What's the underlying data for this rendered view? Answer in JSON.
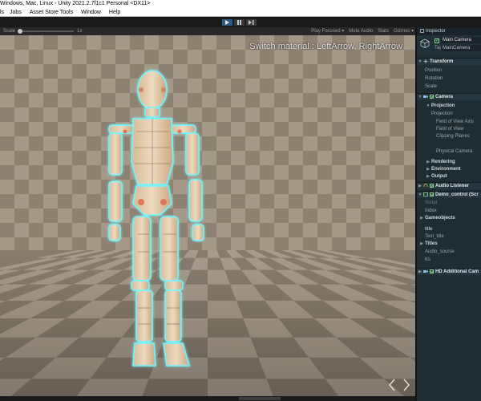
{
  "window": {
    "title": "Windows, Mac, Linux - Unity 2021.2.7f1c1 Personal <DX11>"
  },
  "menu": [
    "ls",
    "Jobs",
    "Asset Store Tools",
    "Window",
    "Help"
  ],
  "game_toolbar": {
    "scale_label": "Scale",
    "scale_value": "1x",
    "play_focused": "Play Focused",
    "mute_audio": "Mute Audio",
    "stats": "Stats",
    "gizmos": "Gizmos"
  },
  "viewport": {
    "switch_text": "Switch material : LeftArrow, RightArrow"
  },
  "inspector": {
    "tab_label": "Inspector",
    "object_name": "Main Camera",
    "tag_label": "Tag",
    "tag_value": "MainCamera",
    "rows": {
      "transform": "Transform",
      "position": "Position",
      "rotation": "Rotation",
      "scale": "Scale",
      "camera": "Camera",
      "projection_group": "Projection",
      "projection": "Projection",
      "fov_axis": "Field of View Axis",
      "fov": "Field of View",
      "clipping": "Clipping Planes",
      "physical_camera": "Physical Camera",
      "rendering": "Rendering",
      "environment": "Environment",
      "output": "Output",
      "audio_listener": "Audio Listener",
      "demo_control": "Demo_control (Scr",
      "script": "Script",
      "index": "Index",
      "gameobjects": "Gameobjects",
      "title": "title",
      "text_title": "Text_title",
      "titles": "Titles",
      "audio_source": "Audio_source",
      "ks": "Ks",
      "hd_camera": "HD Additional Cam"
    }
  },
  "colors": {
    "accent_play": "#2c5d87",
    "inspector_bg": "#1f2d33",
    "hologram_edge": "#6ef5ff",
    "body_tint": "#e5c9a6"
  }
}
